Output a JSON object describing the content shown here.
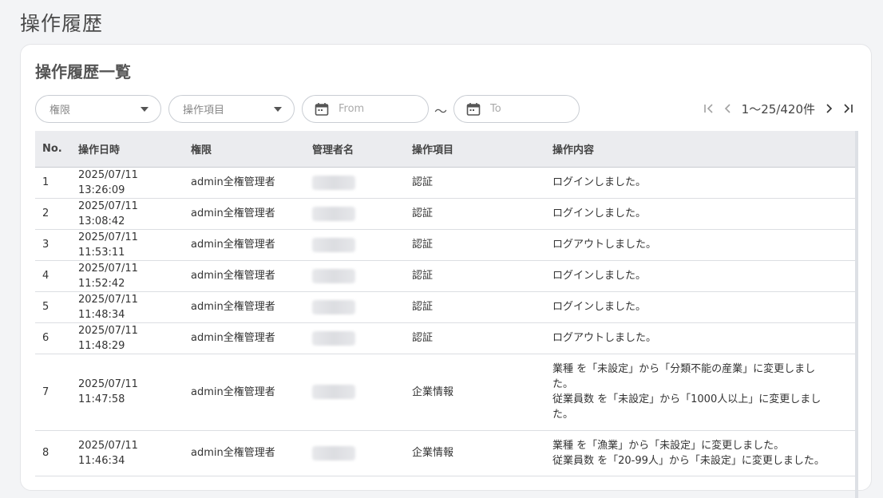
{
  "page": {
    "title": "操作履歴"
  },
  "card": {
    "title": "操作履歴一覧"
  },
  "filters": {
    "authority_placeholder": "権限",
    "operation_item_placeholder": "操作項目",
    "date_from_placeholder": "From",
    "date_separator": "～",
    "date_to_placeholder": "To"
  },
  "pager": {
    "range_text": "1〜25/420件"
  },
  "table": {
    "headers": [
      "No.",
      "操作日時",
      "権限",
      "管理者名",
      "操作項目",
      "操作内容"
    ],
    "rows": [
      {
        "no": "1",
        "datetime": "2025/07/11 13:26:09",
        "authority": "admin全権管理者",
        "item": "認証",
        "content": "ログインしました。"
      },
      {
        "no": "2",
        "datetime": "2025/07/11 13:08:42",
        "authority": "admin全権管理者",
        "item": "認証",
        "content": "ログインしました。"
      },
      {
        "no": "3",
        "datetime": "2025/07/11 11:53:11",
        "authority": "admin全権管理者",
        "item": "認証",
        "content": "ログアウトしました。"
      },
      {
        "no": "4",
        "datetime": "2025/07/11 11:52:42",
        "authority": "admin全権管理者",
        "item": "認証",
        "content": "ログインしました。"
      },
      {
        "no": "5",
        "datetime": "2025/07/11 11:48:34",
        "authority": "admin全権管理者",
        "item": "認証",
        "content": "ログインしました。"
      },
      {
        "no": "6",
        "datetime": "2025/07/11 11:48:29",
        "authority": "admin全権管理者",
        "item": "認証",
        "content": "ログアウトしました。"
      },
      {
        "no": "7",
        "datetime": "2025/07/11 11:47:58",
        "authority": "admin全権管理者",
        "item": "企業情報",
        "content": "業種 を「未設定」から「分類不能の産業」に変更しました。\n従業員数 を「未設定」から「1000人以上」に変更しました。"
      },
      {
        "no": "8",
        "datetime": "2025/07/11 11:46:34",
        "authority": "admin全権管理者",
        "item": "企業情報",
        "content": "業種 を「漁業」から「未設定」に変更しました。\n従業員数 を「20-99人」から「未設定」に変更しました。"
      }
    ]
  },
  "icons": {
    "calendar": "calendar-icon",
    "caret": "caret-down-icon",
    "first": "first-page-icon",
    "prev": "prev-page-icon",
    "next": "next-page-icon",
    "last": "last-page-icon"
  }
}
